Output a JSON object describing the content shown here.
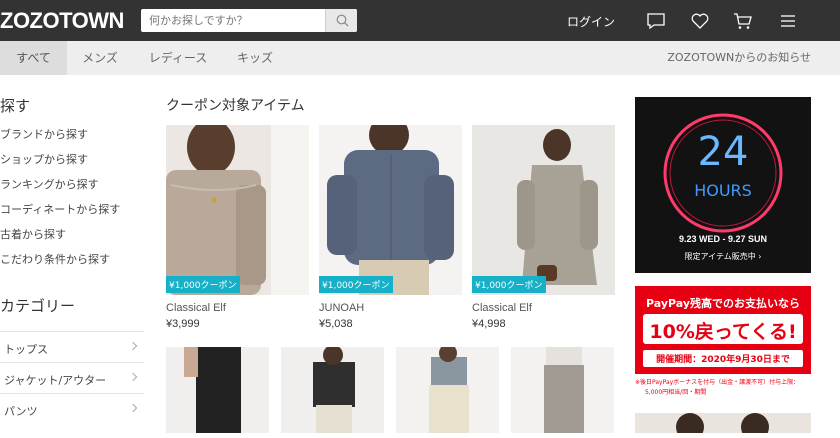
{
  "header": {
    "logo": "ZOZOTOWN",
    "search_placeholder": "何かお探しですか？",
    "login": "ログイン",
    "icons": [
      "chat-icon",
      "heart-icon",
      "cart-icon",
      "menu-icon"
    ]
  },
  "subnav": {
    "tabs": [
      "すべて",
      "メンズ",
      "レディース",
      "キッズ"
    ],
    "active": "すべて",
    "notice": "ZOZOTOWNからのお知らせ"
  },
  "sidebar": {
    "search_title": "探す",
    "links": [
      "ブランドから探す",
      "ショップから探す",
      "ランキングから探す",
      "コーディネートから探す",
      "古着から探す",
      "こだわり条件から探す"
    ],
    "category_title": "カテゴリー",
    "categories": [
      "トップス",
      "ジャケット/アウター",
      "パンツ"
    ]
  },
  "main": {
    "section_title": "クーポン対象アイテム",
    "items": [
      {
        "coupon": "¥1,000クーポン",
        "brand": "Classical Elf",
        "price": "¥3,999"
      },
      {
        "coupon": "¥1,000クーポン",
        "brand": "JUNOAH",
        "price": "¥5,038"
      },
      {
        "coupon": "¥1,000クーポン",
        "brand": "Classical Elf",
        "price": "¥4,998"
      }
    ]
  },
  "ads": {
    "ad1": {
      "big": "24",
      "hours": "HOURS",
      "dates": "9.23 WED - 9.27 SUN",
      "sub": "限定アイテム販売中 ›"
    },
    "ad2": {
      "line1": "PayPay残高でのお支払いなら",
      "line2": "10%戻ってくる!",
      "period": "開催期間：2020年9月30日まで",
      "note1": "※後日PayPayボーナスを付与（出金・譲渡不可）付与上限：",
      "note2": "5,000円相当/回・期間"
    }
  },
  "colors": {
    "header_bg": "#333333",
    "subnav_bg": "#eeeeee",
    "coupon": "#17b0c9",
    "paypay_red": "#e60012"
  }
}
